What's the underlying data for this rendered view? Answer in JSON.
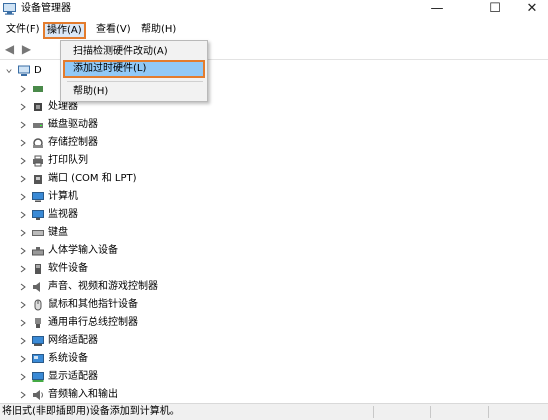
{
  "window": {
    "title": "设备管理器",
    "minimize_glyph": "—",
    "maximize_glyph": "☐",
    "close_glyph": "✕"
  },
  "menubar": {
    "items": [
      {
        "label": "文件(F)"
      },
      {
        "label": "操作(A)"
      },
      {
        "label": "查看(V)"
      },
      {
        "label": "帮助(H)"
      }
    ]
  },
  "toolbar": {
    "back_glyph": "◀",
    "forward_glyph": "▶"
  },
  "dropdown": {
    "items": [
      {
        "label": "扫描检测硬件改动(A)"
      },
      {
        "label": "添加过时硬件(L)"
      },
      {
        "label": "帮助(H)"
      }
    ]
  },
  "tree": {
    "root_label": "D",
    "categories": [
      {
        "label": "处理器",
        "icon": "cpu-icon"
      },
      {
        "label": "磁盘驱动器",
        "icon": "disk-drive-icon"
      },
      {
        "label": "存储控制器",
        "icon": "storage-controller-icon"
      },
      {
        "label": "打印队列",
        "icon": "printer-icon"
      },
      {
        "label": "端口 (COM 和 LPT)",
        "icon": "port-icon"
      },
      {
        "label": "计算机",
        "icon": "computer-icon"
      },
      {
        "label": "监视器",
        "icon": "monitor-icon"
      },
      {
        "label": "键盘",
        "icon": "keyboard-icon"
      },
      {
        "label": "人体学输入设备",
        "icon": "hid-icon"
      },
      {
        "label": "软件设备",
        "icon": "software-device-icon"
      },
      {
        "label": "声音、视频和游戏控制器",
        "icon": "speaker-icon"
      },
      {
        "label": "鼠标和其他指针设备",
        "icon": "mouse-icon"
      },
      {
        "label": "通用串行总线控制器",
        "icon": "usb-icon"
      },
      {
        "label": "网络适配器",
        "icon": "network-adapter-icon"
      },
      {
        "label": "系统设备",
        "icon": "system-device-icon"
      },
      {
        "label": "显示适配器",
        "icon": "display-adapter-icon"
      },
      {
        "label": "音频输入和输出",
        "icon": "audio-io-icon"
      }
    ]
  },
  "statusbar": {
    "text": "将旧式(非即插即用)设备添加到计算机。"
  }
}
